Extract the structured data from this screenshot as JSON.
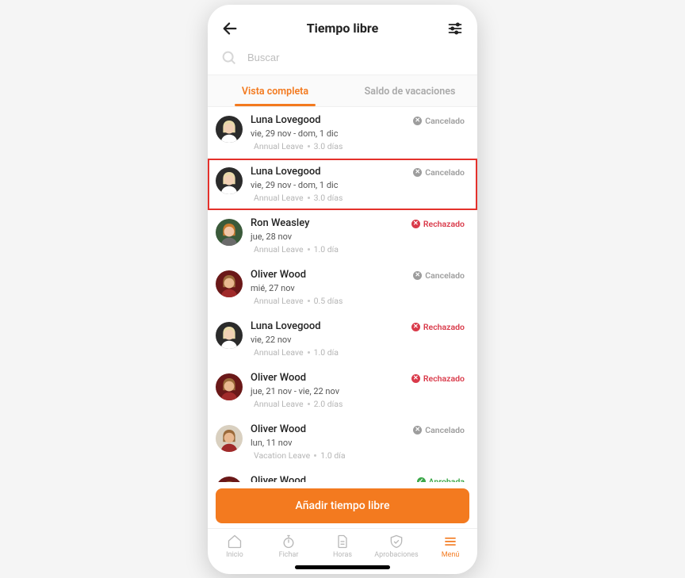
{
  "header": {
    "title": "Tiempo libre"
  },
  "search": {
    "placeholder": "Buscar"
  },
  "tabs": {
    "full_view": "Vista completa",
    "balance": "Saldo de vacaciones"
  },
  "statuses": {
    "cancel": "Cancelado",
    "reject": "Rechazado",
    "approved": "Aprobada"
  },
  "requests": [
    {
      "name": "Luna Lovegood",
      "dates": "vie, 29 nov - dom, 1 dic",
      "type": "Annual Leave",
      "duration": "3.0 días",
      "status": "cancel",
      "avatar": "luna",
      "highlighted": false
    },
    {
      "name": "Luna Lovegood",
      "dates": "vie, 29 nov - dom, 1 dic",
      "type": "Annual Leave",
      "duration": "3.0 días",
      "status": "cancel",
      "avatar": "luna",
      "highlighted": true
    },
    {
      "name": "Ron Weasley",
      "dates": "jue, 28 nov",
      "type": "Annual Leave",
      "duration": "1.0 día",
      "status": "reject",
      "avatar": "ron",
      "highlighted": false
    },
    {
      "name": "Oliver Wood",
      "dates": "mié, 27 nov",
      "type": "Annual Leave",
      "duration": "0.5 días",
      "status": "cancel",
      "avatar": "oliver_b",
      "highlighted": false
    },
    {
      "name": "Luna Lovegood",
      "dates": "vie, 22 nov",
      "type": "Annual Leave",
      "duration": "1.0 día",
      "status": "reject",
      "avatar": "luna",
      "highlighted": false
    },
    {
      "name": "Oliver Wood",
      "dates": "jue, 21 nov - vie, 22 nov",
      "type": "Annual Leave",
      "duration": "2.0 días",
      "status": "reject",
      "avatar": "oliver_b",
      "highlighted": false
    },
    {
      "name": "Oliver Wood",
      "dates": "lun, 11 nov",
      "type": "Vacation Leave",
      "duration": "1.0 día",
      "status": "cancel",
      "avatar": "oliver_a",
      "highlighted": false
    },
    {
      "name": "Oliver Wood",
      "dates": "",
      "type": "",
      "duration": "",
      "status": "approved",
      "avatar": "oliver_b",
      "highlighted": false
    }
  ],
  "fab": {
    "label": "Añadir tiempo libre"
  },
  "nav": {
    "home": "Inicio",
    "clock": "Fichar",
    "hours": "Horas",
    "approvals": "Aprobaciones",
    "menu": "Menú"
  },
  "avatar_palette": {
    "luna": {
      "bg": "#2b2b2b",
      "hair": "#e8d9a8",
      "skin": "#f1d0b5",
      "shirt": "#ffffff"
    },
    "ron": {
      "bg": "#3a5a3a",
      "hair": "#c87a2e",
      "skin": "#f1c7a8",
      "shirt": "#6b6b6b"
    },
    "oliver_a": {
      "bg": "#d9d0c0",
      "hair": "#9a6a3a",
      "skin": "#e8b890",
      "shirt": "#a02a2a"
    },
    "oliver_b": {
      "bg": "#6a1818",
      "hair": "#9a6a3a",
      "skin": "#e8b890",
      "shirt": "#a02a2a"
    }
  }
}
